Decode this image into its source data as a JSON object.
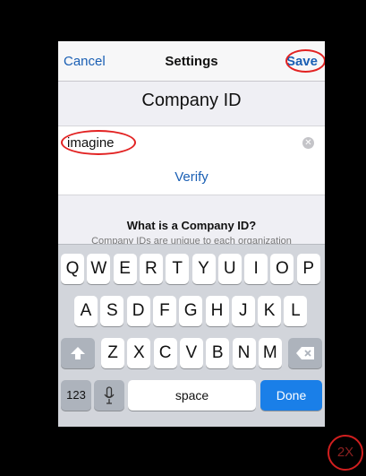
{
  "nav": {
    "cancel_label": "Cancel",
    "title": "Settings",
    "save_label": "Save"
  },
  "form": {
    "heading": "Company ID",
    "company_id_value": "imagine",
    "verify_label": "Verify",
    "info_title": "What is a Company ID?",
    "info_text": "Company IDs are unique to each organization"
  },
  "keyboard": {
    "row1": [
      "Q",
      "W",
      "E",
      "R",
      "T",
      "Y",
      "U",
      "I",
      "O",
      "P"
    ],
    "row2": [
      "A",
      "S",
      "D",
      "F",
      "G",
      "H",
      "J",
      "K",
      "L"
    ],
    "row3": [
      "Z",
      "X",
      "C",
      "V",
      "B",
      "N",
      "M"
    ],
    "numbers_label": "123",
    "space_label": "space",
    "done_label": "Done"
  },
  "zoom_label": "2X",
  "colors": {
    "accent": "#1a5fb4",
    "annotation": "#e22222",
    "done": "#1a7fe8"
  },
  "icons": {
    "clear": "clear-icon",
    "shift": "shift-icon",
    "delete": "delete-icon",
    "mic": "microphone-icon"
  }
}
